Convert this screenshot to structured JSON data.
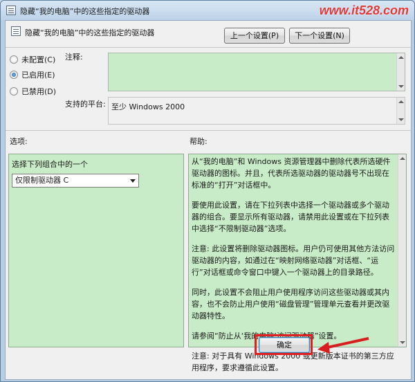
{
  "window": {
    "title": "隐藏“我的电脑”中的这些指定的驱动器",
    "watermark": "www.it528.com"
  },
  "header": {
    "policy_title": "隐藏“我的电脑”中的这些指定的驱动器",
    "prev_label": "上一个设置(P)",
    "next_label": "下一个设置(N)"
  },
  "state": {
    "options": [
      {
        "label": "未配置(C)",
        "checked": false
      },
      {
        "label": "已启用(E)",
        "checked": true
      },
      {
        "label": "已禁用(D)",
        "checked": false
      }
    ]
  },
  "comment": {
    "label": "注释:",
    "value": ""
  },
  "platform": {
    "label": "支持的平台:",
    "value": "至少 Windows 2000"
  },
  "options_section": {
    "label": "选项:",
    "combo_label": "选择下列组合中的一个",
    "selected": "仅限制驱动器 C"
  },
  "help_section": {
    "label": "帮助:",
    "paragraphs": [
      "从“我的电脑”和 Windows 资源管理器中删除代表所选硬件驱动器的图标。并且，代表所选驱动器的驱动器号不出现在标准的“打开”对话框中。",
      "要使用此设置，请在下拉列表中选择一个驱动器或多个驱动器的组合。要显示所有驱动器，请禁用此设置或在下拉列表中选择“不限制驱动器”选项。",
      "注意: 此设置将删除驱动器图标。用户仍可使用其他方法访问驱动器的内容，如通过在“映射网络驱动器”对话框、“运行”对话框或命令窗口中键入一个驱动器上的目录路径。",
      "同时，此设置不会阻止用户使用程序访问这些驱动器或其内容，也不会防止用户使用“磁盘管理”管理单元查看并更改驱动器特性。",
      "请参阅“防止从‘我的电脑’访问驱动器”设置。",
      "注意: 对于具有 Windows 2000 或更新版本证书的第三方应用程序，要求遵循此设置。"
    ]
  },
  "footer": {
    "ok_label": "确定"
  },
  "colors": {
    "panel_bg": "#c8ecc8",
    "highlight": "#e02020"
  }
}
